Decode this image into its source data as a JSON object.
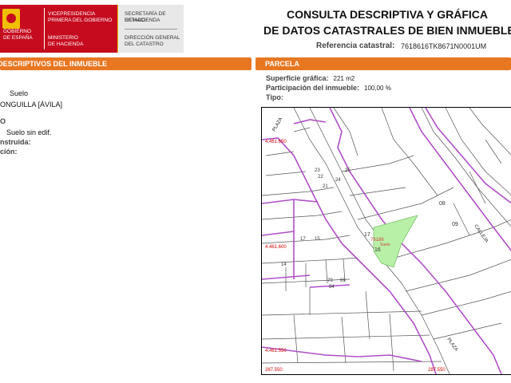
{
  "header": {
    "logo": {
      "country_line1": "GOBIERNO",
      "country_line2": "DE ESPAÑA",
      "vp_line1": "VICEPRESIDENCIA",
      "vp_line2": "PRIMERA DEL GOBIERNO",
      "min_line1": "MINISTERIO",
      "min_line2": "DE HACIENDA",
      "sec_line1": "SECRETARÍA DE ESTADO",
      "sec_line2": "DE HACIENDA",
      "dir_line1": "DIRECCIÓN GENERAL",
      "dir_line2": "DEL CATASTRO"
    },
    "title_line1": "CONSULTA DESCRIPTIVA Y GRÁFICA",
    "title_line2": "DE DATOS CATASTRALES DE BIEN INMUEBLE",
    "ref_label": "Referencia catastral:",
    "ref_value": "7618616TK8671N0001UM"
  },
  "left": {
    "section_title": "DATOS DESCRIPTIVOS DEL INMUEBLE",
    "lines": {
      "clase_value": "Suelo",
      "localizacion_value": "ONGUILLA [ÁVILA]",
      "uso_heading": "O",
      "uso_value": "Suelo sin edif.",
      "construida_label": "nstruida:",
      "construccion_label": "ción:"
    }
  },
  "parcela": {
    "section_title": "PARCELA",
    "superficie_label": "Superficie gráfica:",
    "superficie_value": "221 m2",
    "participacion_label": "Participación del inmueble:",
    "participacion_value": "100,00 %",
    "tipo_label": "Tipo:",
    "tipo_value": ""
  },
  "map": {
    "parcel_color": "#b9f0a8",
    "boundary_color": "#b04fc8",
    "coord_color": "#d00000",
    "coords": {
      "y1": "4.461.650",
      "y2": "4.461.600",
      "y3": "4.461.550",
      "x1": "287.550",
      "x2": "287.550"
    },
    "labels": {
      "street_plaza_top": "PLAZA",
      "street_calleja": "CALLEJA",
      "street_plaza_bottom": "PLAZA",
      "parcel_ref": "76186",
      "parcel_type": "Suelo",
      "n08": "08",
      "n09": "09",
      "n17": "17",
      "n16": "16",
      "n15": "15",
      "n14": "14",
      "n70": "70",
      "n69": "69",
      "n84": "84",
      "n21": "21",
      "n22": "22",
      "n23": "23",
      "n24": "24",
      "n25": "25"
    }
  }
}
